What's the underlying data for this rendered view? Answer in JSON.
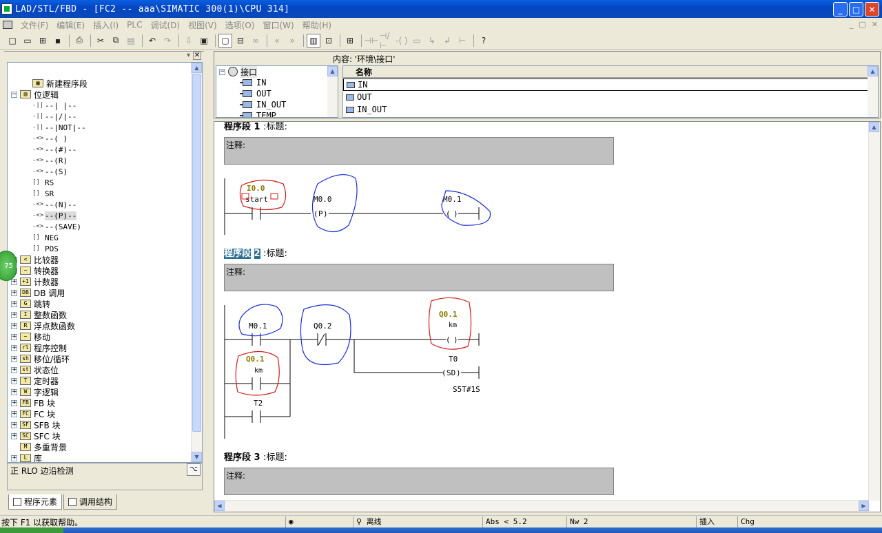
{
  "window": {
    "title": "LAD/STL/FBD  - [FC2 -- aaa\\SIMATIC 300(1)\\CPU 314]",
    "min_label": "_",
    "max_label": "□",
    "close_label": "✕"
  },
  "menu": {
    "items": [
      "文件(F)",
      "编辑(E)",
      "插入(I)",
      "PLC",
      "调试(D)",
      "视图(V)",
      "选项(O)",
      "窗口(W)",
      "帮助(H)"
    ],
    "mdi_controls": [
      "_",
      "□",
      "✕"
    ]
  },
  "toolbar": {
    "icons": [
      "new-icon",
      "open-icon",
      "accessible-nodes-icon",
      "save-icon",
      "print-icon",
      "cut-icon",
      "copy-icon",
      "paste-icon",
      "undo-icon",
      "redo-icon",
      "download-icon",
      "monitor-icon",
      "overview-icon",
      "module-info-icon",
      "monitoring-glasses-icon",
      "first-network-icon",
      "last-network-icon",
      "ladder-icon",
      "program-elements-icon",
      "network-icon",
      "no-contact-icon",
      "nc-contact-icon",
      "coil-icon",
      "box-icon",
      "branch-open-icon",
      "branch-close-icon",
      "connector-icon",
      "help-icon"
    ]
  },
  "sidebar": {
    "top_item": "新建程序段",
    "bit_logic": {
      "label": "位逻辑",
      "expander": "−",
      "items": [
        {
          "icon": "-||",
          "label": "--|  |--"
        },
        {
          "icon": "-||",
          "label": "--|/|--"
        },
        {
          "icon": "-||",
          "label": "--|NOT|--"
        },
        {
          "icon": "-<>",
          "label": "--( )"
        },
        {
          "icon": "-<>",
          "label": "--(#)--"
        },
        {
          "icon": "-<>",
          "label": "--(R)"
        },
        {
          "icon": "-<>",
          "label": "--(S)"
        },
        {
          "icon": "[]",
          "label": "RS"
        },
        {
          "icon": "[]",
          "label": "SR"
        },
        {
          "icon": "-<>",
          "label": "--(N)--"
        },
        {
          "icon": "-<>",
          "label": "--(P)--",
          "selected": true
        },
        {
          "icon": "-<>",
          "label": "--(SAVE)"
        },
        {
          "icon": "[]",
          "label": "NEG"
        },
        {
          "icon": "[]",
          "label": "POS"
        }
      ]
    },
    "groups": [
      {
        "expander": "+",
        "icon": "<",
        "label": "比较器"
      },
      {
        "expander": "+",
        "icon": "~",
        "label": "转换器"
      },
      {
        "expander": "+",
        "icon": "+1",
        "label": "计数器"
      },
      {
        "expander": "+",
        "icon": "DB",
        "label": "DB 调用"
      },
      {
        "expander": "+",
        "icon": "G",
        "label": "跳转"
      },
      {
        "expander": "+",
        "icon": "I",
        "label": "整数函数"
      },
      {
        "expander": "+",
        "icon": "R",
        "label": "浮点数函数"
      },
      {
        "expander": "+",
        "icon": "~",
        "label": "移动"
      },
      {
        "expander": "+",
        "icon": "rl",
        "label": "程序控制"
      },
      {
        "expander": "+",
        "icon": "sh",
        "label": "移位/循环"
      },
      {
        "expander": "+",
        "icon": "st",
        "label": "状态位"
      },
      {
        "expander": "+",
        "icon": "T",
        "label": "定时器"
      },
      {
        "expander": "+",
        "icon": "W",
        "label": "字逻辑"
      },
      {
        "expander": "+",
        "icon": "FB",
        "label": "FB 块"
      },
      {
        "expander": "+",
        "icon": "FC",
        "label": "FC 块"
      },
      {
        "expander": "+",
        "icon": "SF",
        "label": "SFB 块"
      },
      {
        "expander": "+",
        "icon": "SC",
        "label": "SFC 块"
      },
      {
        "expander": "",
        "icon": "M",
        "label": "多重背景"
      },
      {
        "expander": "+",
        "icon": "L",
        "label": "库"
      }
    ],
    "description": "正 RLO 边沿检测",
    "desc_icon": "⌥",
    "tabs": [
      "程序元素",
      "调用结构"
    ],
    "badge": "75"
  },
  "interface": {
    "content_label": "内容:  '环境\\接口'",
    "tree": {
      "expander": "−",
      "root": "接口",
      "items": [
        "IN",
        "OUT",
        "IN_OUT",
        "TEMP"
      ]
    },
    "grid": {
      "header": "名称",
      "rows": [
        "IN",
        "OUT",
        "IN_OUT"
      ]
    }
  },
  "editor": {
    "networks": [
      {
        "prefix": "程序段",
        "num": "1",
        "suffix": ":标题:",
        "comment_label": "注释:"
      },
      {
        "prefix": "程序段",
        "num": "2",
        "suffix": ":标题:",
        "comment_label": "注释:"
      },
      {
        "prefix": "程序段",
        "num": "3",
        "suffix": ":标题:",
        "comment_label": "注释:"
      }
    ],
    "net1": {
      "contact1_addr": "I0.0",
      "contact1_sym": "start",
      "edge_addr": "M0.0",
      "edge_op": "P",
      "coil_addr": "M0.1",
      "coil_op": " "
    },
    "net2": {
      "c1_addr": "M0.1",
      "c2_addr": "Q0.2",
      "coil_addr": "Q0.1",
      "coil_sym": "km",
      "coil_op": " ",
      "p_addr": "Q0.1",
      "p_sym": "km",
      "t2_addr": "T2",
      "timer_addr": "T0",
      "timer_op": "SD",
      "timer_val": "S5T#1S"
    }
  },
  "statusbar": {
    "help": "按下 F1 以获取帮助。",
    "mode": "离线",
    "abs": "Abs < 5.2",
    "nw": "Nw 2",
    "insert": "插入",
    "chg": "Chg"
  },
  "colors": {
    "title_bar": "#0a4ab8",
    "selected_network": "#2b6f92",
    "annotation_red": "#d21a1a",
    "annotation_blue": "#1a2fd2",
    "symbol_olive": "#8a7a00"
  }
}
